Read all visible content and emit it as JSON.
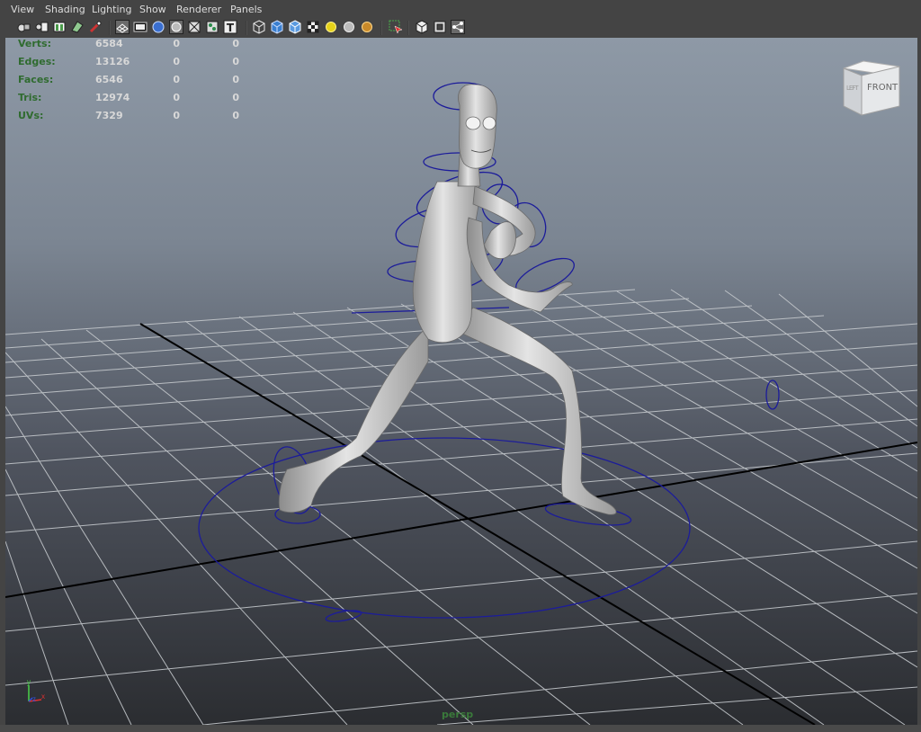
{
  "menu": {
    "items": [
      "View",
      "Shading",
      "Lighting",
      "Show",
      "Renderer",
      "Panels"
    ]
  },
  "toolbar": {
    "buttons": [
      "camera-attributes-icon",
      "bookmark-icon",
      "image-plane-icon",
      "two-d-pan-zoom-icon",
      "grease-pencil-icon",
      "grid-icon",
      "film-gate-icon",
      "resolution-gate-icon",
      "gate-mask-icon",
      "field-chart-icon",
      "safe-action-icon",
      "safe-title-icon",
      "wireframe-icon",
      "smooth-shade-icon",
      "wireframe-on-shaded-icon",
      "textured-icon",
      "default-light-icon",
      "all-lights-icon",
      "shadows-icon",
      "xray-select-icon",
      "isolate-select-icon",
      "xray-icon",
      "xray-joints-icon"
    ]
  },
  "hud": {
    "rows": [
      {
        "label": "Verts:",
        "v1": "6584",
        "v2": "0",
        "v3": "0"
      },
      {
        "label": "Edges:",
        "v1": "13126",
        "v2": "0",
        "v3": "0"
      },
      {
        "label": "Faces:",
        "v1": "6546",
        "v2": "0",
        "v3": "0"
      },
      {
        "label": "Tris:",
        "v1": "12974",
        "v2": "0",
        "v3": "0"
      },
      {
        "label": "UVs:",
        "v1": "7329",
        "v2": "0",
        "v3": "0"
      }
    ]
  },
  "viewcube": {
    "front_label": "FRONT",
    "left_label": "LEFT"
  },
  "axis": {
    "x_label": "x",
    "y_label": "y",
    "z_label": "z"
  },
  "camera_name": "persp",
  "colors": {
    "hud_label": "#2f6b2f",
    "camera_name": "#3a7a3a",
    "rig_controls": "#1c1c9a",
    "grid_line": "#c4c8cc",
    "grid_axis": "#000000"
  }
}
